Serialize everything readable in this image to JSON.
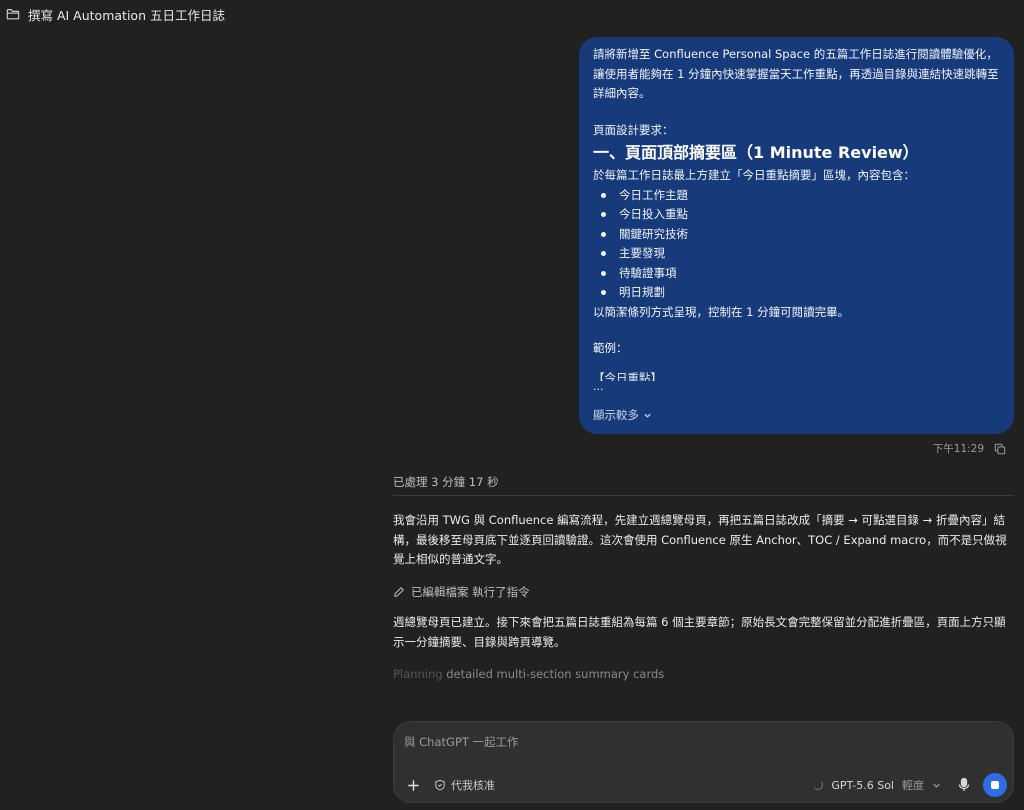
{
  "window": {
    "title": "撰寫 AI Automation 五日工作日誌"
  },
  "user_message": {
    "intro": "請將新增至 Confluence Personal Space 的五篇工作日誌進行閱讀體驗優化，讓使用者能夠在 1 分鐘內快速掌握當天工作重點，再透過目錄與連結快速跳轉至詳細內容。",
    "section_label": "頁面設計要求：",
    "heading": "一、頁面頂部摘要區（1 Minute Review）",
    "lead": "於每篇工作日誌最上方建立「今日重點摘要」區塊，內容包含：",
    "bullets": [
      "今日工作主題",
      "今日投入重點",
      "關鍵研究技術",
      "主要發現",
      "待驗證事項",
      "明日規劃"
    ],
    "closing": "以簡潔條列方式呈現，控制在 1 分鐘可閱讀完畢。",
    "example_label": "範例：",
    "cut_text": "【今日重點】",
    "ellipsis": "...",
    "show_more": "顯示較多",
    "timestamp": "下午11:29"
  },
  "assistant": {
    "processed": "已處理 3 分鐘 17 秒",
    "paragraph1": "我會沿用 TWG 與 Confluence 編寫流程，先建立週總覽母頁，再把五篇日誌改成「摘要 → 可點選目錄 → 折疊內容」結構，最後移至母頁底下並逐頁回讀驗證。這次會使用 Confluence 原生 Anchor、TOC / Expand macro，而不是只做視覺上相似的普通文字。",
    "edited_status": "已編輯檔案 執行了指令",
    "paragraph2": "週總覽母頁已建立。接下來會把五篇日誌重組為每篇 6 個主要章節；原始長文會完整保留並分配進折疊區，頁面上方只顯示一分鐘摘要、目錄與跨頁導覽。",
    "planning_faint": "Planning",
    "planning_rest": " detailed multi-section summary cards"
  },
  "composer": {
    "placeholder": "與 ChatGPT 一起工作",
    "approve_label": "代我核准",
    "model_name": "GPT-5.6 Sol",
    "model_mode": "輕度"
  },
  "colors": {
    "background": "#212121",
    "user_bubble": "#173b7a",
    "send_button": "#2f6de6"
  }
}
